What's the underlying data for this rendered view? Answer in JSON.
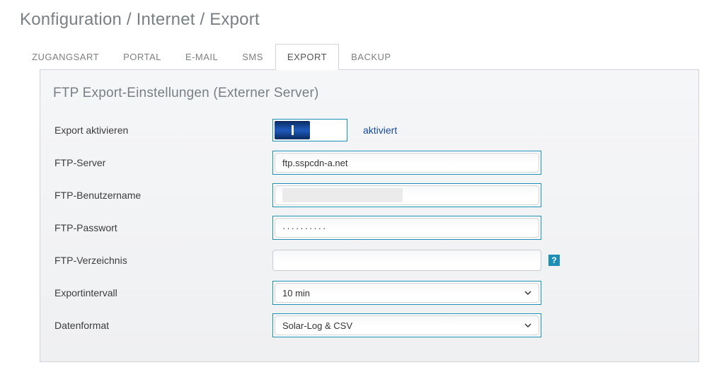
{
  "breadcrumb": "Konfiguration / Internet / Export",
  "tabs": [
    {
      "label": "ZUGANGSART",
      "active": false
    },
    {
      "label": "PORTAL",
      "active": false
    },
    {
      "label": "E-MAIL",
      "active": false
    },
    {
      "label": "SMS",
      "active": false
    },
    {
      "label": "EXPORT",
      "active": true
    },
    {
      "label": "BACKUP",
      "active": false
    }
  ],
  "section_title": "FTP Export-Einstellungen (Externer Server)",
  "labels": {
    "activate": "Export aktivieren",
    "server": "FTP-Server",
    "user": "FTP-Benutzername",
    "password": "FTP-Passwort",
    "directory": "FTP-Verzeichnis",
    "interval": "Exportintervall",
    "format": "Datenformat"
  },
  "toggle": {
    "on": true,
    "status_text": "aktiviert"
  },
  "fields": {
    "server": "ftp.sspcdn-a.net",
    "user": "",
    "password_mask": "··········",
    "directory": "",
    "interval": "10 min",
    "format": "Solar-Log & CSV"
  },
  "help_icon_text": "?"
}
